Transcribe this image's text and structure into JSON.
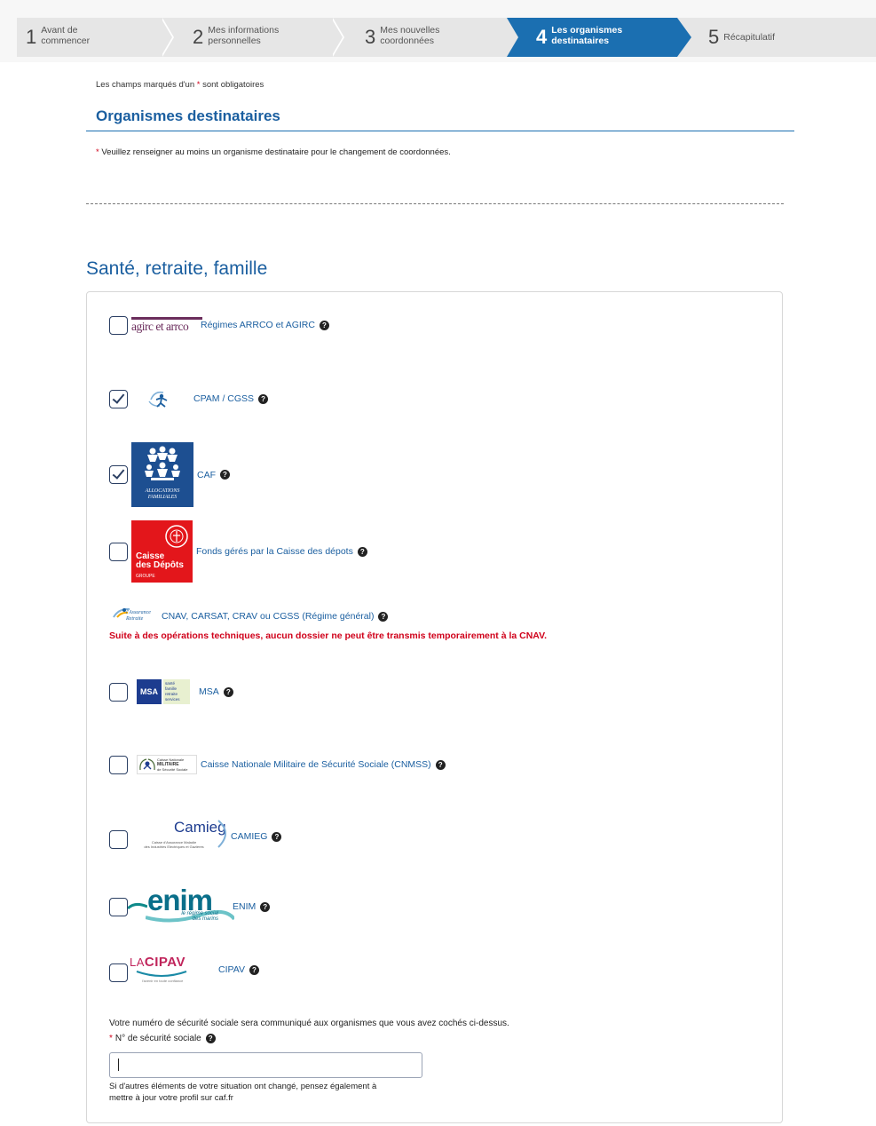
{
  "stepper": {
    "steps": [
      {
        "num": "1",
        "label_line1": "Avant de",
        "label_line2": "commencer",
        "active": false
      },
      {
        "num": "2",
        "label_line1": "Mes informations",
        "label_line2": "personnelles",
        "active": false
      },
      {
        "num": "3",
        "label_line1": "Mes nouvelles",
        "label_line2": "coordonnées",
        "active": false
      },
      {
        "num": "4",
        "label_line1": "Les organismes",
        "label_line2": "destinataires",
        "active": true
      },
      {
        "num": "5",
        "label_line1": "Récapitulatif",
        "label_line2": "",
        "active": false
      }
    ]
  },
  "form": {
    "required_note_pre": "Les champs marqués d'un ",
    "required_star": "*",
    "required_note_post": " sont obligatoires",
    "section_title": "Organismes destinataires",
    "warning_star": "*",
    "warning_text": " Veuillez renseigner au moins un organisme destinataire pour le changement de coordonnées.",
    "subsection_title": "Santé, retraite, famille"
  },
  "organisms": [
    {
      "label": "Régimes ARRCO et AGIRC",
      "checked": false,
      "logo": "agirc-arrco-logo",
      "logo_text": "agirc et arrco"
    },
    {
      "label": "CPAM / CGSS",
      "checked": true,
      "logo": "assurance-maladie-logo"
    },
    {
      "label": "CAF",
      "checked": true,
      "logo": "caf-logo",
      "logo_text_1": "ALLOCATIONS",
      "logo_text_2": "FAMILIALES"
    },
    {
      "label": "Fonds gérés par la Caisse des dépots",
      "checked": false,
      "logo": "caisse-des-depots-logo",
      "logo_text_1": "Caisse",
      "logo_text_2": "des Dépôts",
      "logo_text_3": "GROUPE"
    },
    {
      "label": "CNAV, CARSAT, CRAV ou CGSS (Régime général)",
      "checked": null,
      "logo": "assurance-retraite-logo",
      "logo_text_1": "l'Assurance",
      "logo_text_2": "Retraite"
    },
    {
      "label": "MSA",
      "checked": false,
      "logo": "msa-logo",
      "logo_text": "MSA",
      "logo_lines": [
        "santé",
        "famille",
        "retraite",
        "services"
      ]
    },
    {
      "label": "Caisse Nationale Militaire de Sécurité Sociale (CNMSS)",
      "checked": false,
      "logo": "cnmss-logo",
      "logo_text_1": "Caisse Nationale",
      "logo_text_2": "MILITAIRE",
      "logo_text_3": "de Sécurité Sociale"
    },
    {
      "label": "CAMIEG",
      "checked": false,
      "logo": "camieg-logo",
      "logo_text_1": "Camieg",
      "logo_text_2": "Caisse d'Assurance Maladie",
      "logo_text_3": "des Industries Electriques et Gazières"
    },
    {
      "label": "ENIM",
      "checked": false,
      "logo": "enim-logo",
      "logo_text_1": "enim",
      "logo_text_2": "le régime social",
      "logo_text_3": "des marins"
    },
    {
      "label": "CIPAV",
      "checked": false,
      "logo": "cipav-logo",
      "logo_text_1": "LA",
      "logo_text_2": "CIPAV",
      "logo_text_3": "l'avenir en toute confiance"
    }
  ],
  "cnav_warning": "Suite à des opérations techniques, aucun dossier ne peut être transmis temporairement à la CNAV.",
  "social_security": {
    "note": "Votre numéro de sécurité sociale sera communiqué aux organismes que vous avez cochés ci-dessus.",
    "label_star": "*",
    "label": "N° de sécurité sociale",
    "value": "",
    "update_note": "Si d'autres éléments de votre situation ont changé, pensez également à mettre à jour votre profil sur caf.fr"
  },
  "colors": {
    "accent": "#1b6fb1",
    "title": "#1b5fa0",
    "required": "#d0021b"
  }
}
